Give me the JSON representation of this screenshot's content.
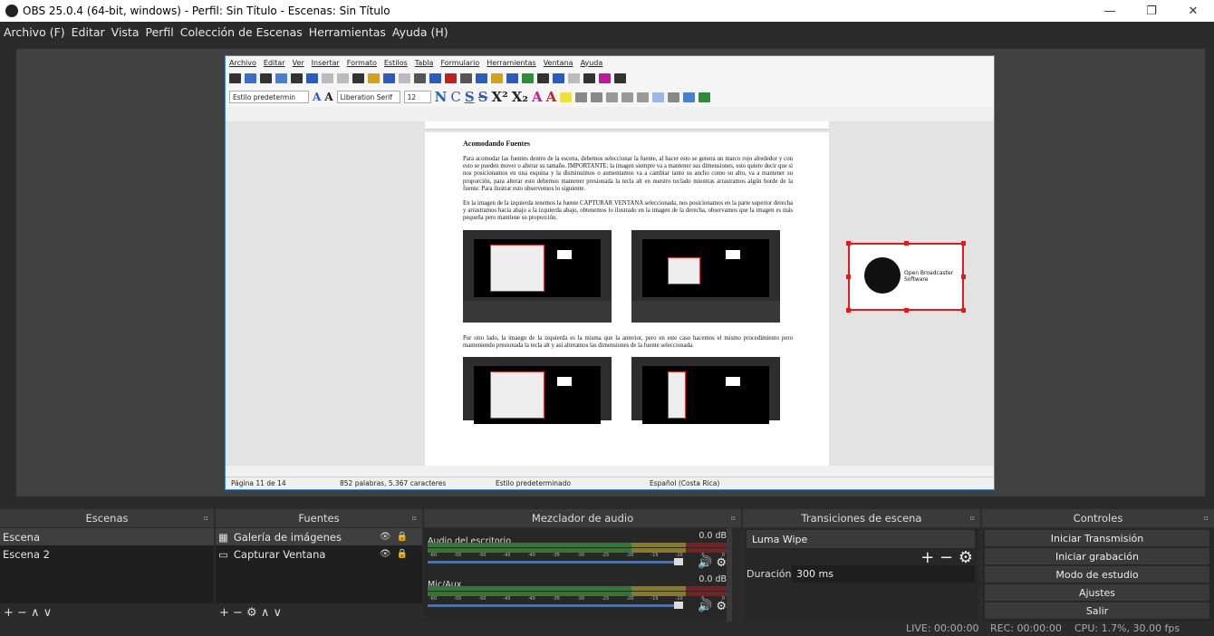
{
  "window": {
    "title": "OBS 25.0.4 (64-bit, windows) - Perfil: Sin Título - Escenas: Sin Título",
    "minimize": "—",
    "maximize": "❐",
    "close": "✕"
  },
  "menu": [
    "Archivo (F)",
    "Editar",
    "Vista",
    "Perfil",
    "Colección de Escenas",
    "Herramientas",
    "Ayuda (H)"
  ],
  "writer": {
    "menu": [
      "Archivo",
      "Editar",
      "Ver",
      "Insertar",
      "Formato",
      "Estilos",
      "Tabla",
      "Formulario",
      "Herramientas",
      "Ventana",
      "Ayuda"
    ],
    "style_box": "Estilo predetermin",
    "font_box": "Liberation Serif",
    "size_box": "12",
    "doc_title": "Acomodando Fuentes",
    "para1": "Para acomodar las fuentes dentro de la escena, debemos seleccionar la fuente, al hacer esto se genera un marco rojo alrededor y con esto se pueden mover o alterar su tamaño. IMPORTANTE: la imagen siempre va a mantener sus dimensiones, esto quiere decir que si nos posicionamos en una esquina y la disminuimos o aumentamos va a cambiar tanto su ancho como su alto, va a mantener su proporción, para alterar esto debemos mantener presionada la tecla alt en nuestro teclado mientras arrastramos algún borde de la fuente. Para ilustrar esto observemos lo siguiente.",
    "para2": "En la imagen de la izquierda tenemos la fuente CAPTURAR VENTANA seleccionada, nos posicionamos en la parte superior derecha y arrastramos hacia abajo a la izquierda abajo, obtenemos lo ilustrado en la imagen de la derecha, observamos que la imagen es más pequeña pero mantiene su proporción.",
    "para3": "Por otro lado, la imaegn de la izquierda es la misma que la anterior, pero en este caso hacemos el mismo procedimiento pero manteniendo presionada la tecla alt y así alteramos las dimensiones de la fuente seleccionada.",
    "status": {
      "page": "Página 11 de 14",
      "words": "852 palabras, 5.367 caracteres",
      "style": "Estilo predeterminado",
      "lang": "Español (Costa Rica)"
    }
  },
  "obs_source": {
    "line1": "Open Broadcaster",
    "line2": "Software"
  },
  "docks": {
    "scenes": {
      "title": "Escenas",
      "items": [
        "Escena",
        "Escena 2"
      ],
      "footer": "+ −  ∧ ∨"
    },
    "sources": {
      "title": "Fuentes",
      "items": [
        "Galería de imágenes",
        "Capturar Ventana"
      ],
      "footer": "+ − ⚙  ∧ ∨"
    },
    "mixer": {
      "title": "Mezclador de audio",
      "tracks": [
        {
          "name": "Audio del escritorio",
          "db": "0.0 dB"
        },
        {
          "name": "Mic/Aux",
          "db": "0.0 dB"
        }
      ],
      "scale": [
        "-60",
        "-55",
        "-50",
        "-45",
        "-40",
        "-35",
        "-30",
        "-25",
        "-20",
        "-15",
        "-10",
        "-5",
        "0"
      ]
    },
    "transitions": {
      "title": "Transiciones de escena",
      "selected": "Luma Wipe",
      "duration_label": "Duración",
      "duration_value": "300 ms"
    },
    "controls": {
      "title": "Controles",
      "buttons": [
        "Iniciar Transmisión",
        "Iniciar grabación",
        "Modo de estudio",
        "Ajustes",
        "Salir"
      ]
    }
  },
  "status": {
    "live": "LIVE: 00:00:00",
    "rec": "REC: 00:00:00",
    "cpu": "CPU: 1.7%, 30.00 fps"
  }
}
